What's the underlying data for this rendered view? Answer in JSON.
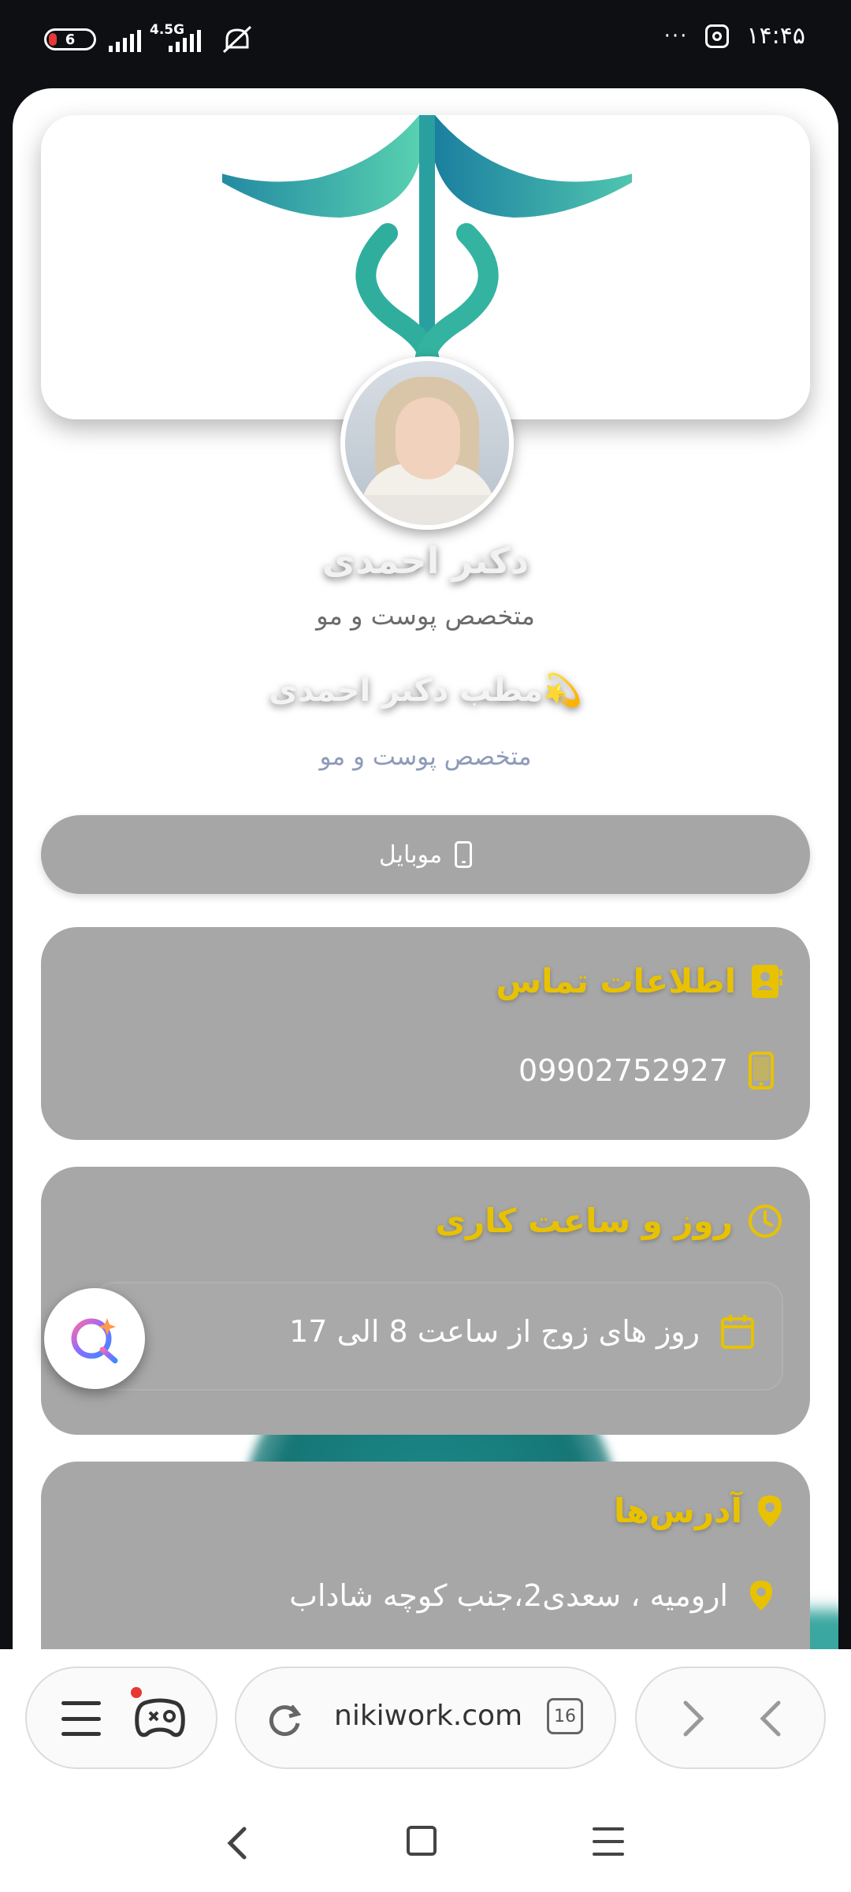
{
  "status": {
    "battery": "6",
    "network": "4.5G",
    "time": "۱۴:۴۵",
    "more": "···"
  },
  "profile": {
    "name": "دکتر احمدی",
    "specialty": "متخصص پوست و مو",
    "clinic": "مطب دکتر احمدی💫",
    "clinic_specialty": "متخصص پوست و مو"
  },
  "mobile_button": {
    "label": "موبایل"
  },
  "contact": {
    "title": "اطلاعات تماس",
    "phone": "09902752927"
  },
  "hours": {
    "title": "روز و ساعت کاری",
    "schedule": "روز های زوج از ساعت 8 الی 17"
  },
  "addresses": {
    "title": "آدرس‌ها",
    "address": "ارومیه ، سعدی2،جنب کوچه شاداب"
  },
  "browser": {
    "url": "nikiwork.com",
    "tabs": "16"
  },
  "colors": {
    "accent": "#e8c200",
    "card": "#a7a7a7",
    "teal": "#2aa6a0"
  }
}
